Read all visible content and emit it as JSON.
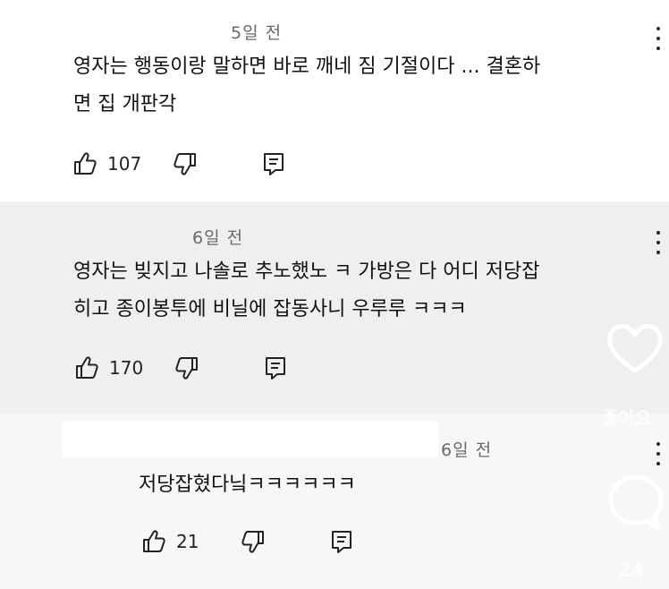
{
  "comments": [
    {
      "time": "5일 전",
      "text_line1": "영자는 행동이랑 말하면 바로 깨네 짐 기절이다 ... 결혼하",
      "text_line2": "면 집 개판각",
      "likes": "107"
    },
    {
      "time": "6일 전",
      "text_line1": "영자는 빚지고 나솔로 추노했노 ㅋ 가방은 다 어디 저당잡",
      "text_line2": "히고 종이봉투에 비닐에 잡동사니 우루루 ㅋㅋㅋ",
      "likes": "170"
    }
  ],
  "reply": {
    "time": "6일 전",
    "text": "저당잡혔다닠ㅋㅋㅋㅋㅋㅋ",
    "likes": "21"
  },
  "overlay": {
    "like_label": "좋아요",
    "comment_count": "24"
  },
  "icons": {
    "thumb_up": "thumb-up-icon",
    "thumb_down": "thumb-down-icon",
    "reply": "reply-icon",
    "more": "more-vert-icon",
    "heart": "heart-icon",
    "comment_bubble": "comment-bubble-icon"
  }
}
